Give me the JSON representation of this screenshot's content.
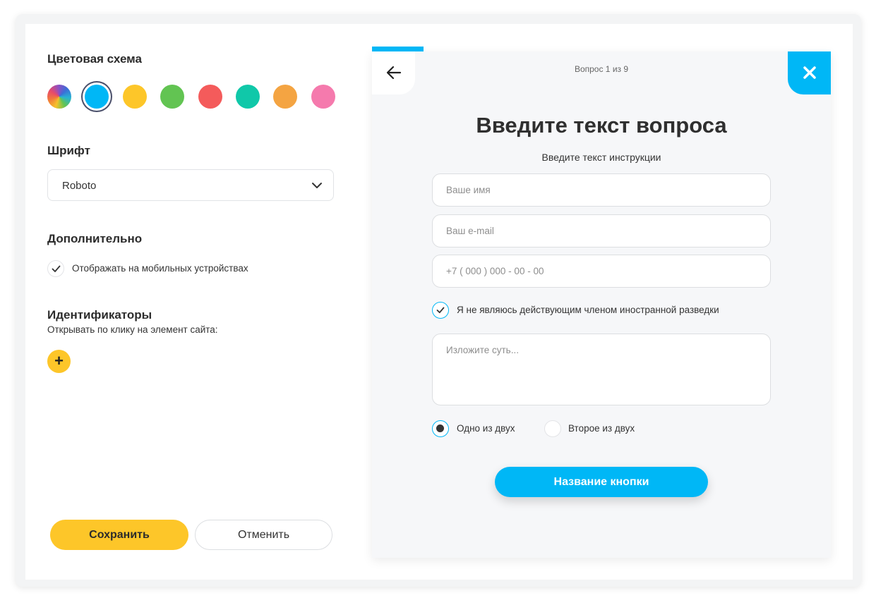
{
  "settings": {
    "color_scheme_title": "Цветовая схема",
    "color_swatches": [
      {
        "name": "gradient",
        "color": "conic"
      },
      {
        "name": "blue",
        "color": "#00b7f6",
        "selected": true
      },
      {
        "name": "yellow",
        "color": "#fdc629"
      },
      {
        "name": "green",
        "color": "#62c452"
      },
      {
        "name": "red",
        "color": "#f45b5b"
      },
      {
        "name": "teal",
        "color": "#10c8a9"
      },
      {
        "name": "orange",
        "color": "#f4a442"
      },
      {
        "name": "pink",
        "color": "#f57aad"
      }
    ],
    "font_title": "Шрифт",
    "font_value": "Roboto",
    "extra_title": "Дополнительно",
    "mobile_checkbox_label": "Отображать на мобильных устройствах",
    "mobile_checked": true,
    "identifiers_title": "Идентификаторы",
    "identifiers_subtitle": "Открывать по клику на элемент сайта:",
    "add_label": "+",
    "save_label": "Сохранить",
    "cancel_label": "Отменить"
  },
  "preview": {
    "progress": 0.11,
    "counter": "Вопрос 1 из 9",
    "title": "Введите текст вопроса",
    "instruction": "Введите текст инструкции",
    "name_placeholder": "Ваше имя",
    "email_placeholder": "Ваш e-mail",
    "phone_placeholder": "+7 ( 000 ) 000 - 00 - 00",
    "consent_label": "Я не являюсь действующим членом иностранной разведки",
    "consent_checked": true,
    "message_placeholder": "Изложите суть...",
    "radio_option_1": "Одно из двух",
    "radio_option_2": "Второе из двух",
    "radio_selected": 1,
    "submit_label": "Название кнопки"
  },
  "colors": {
    "accent": "#00b7f6",
    "primary_yellow": "#fdc629"
  }
}
